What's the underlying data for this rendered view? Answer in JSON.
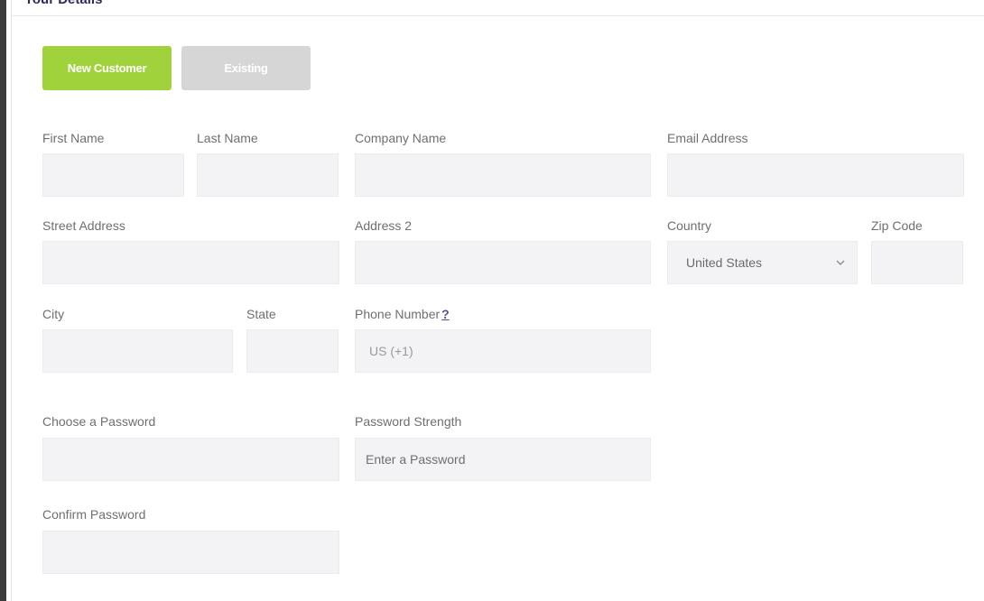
{
  "panel": {
    "title": "Your Details"
  },
  "customer_toggle": {
    "new_label": "New Customer",
    "existing_label": "Existing",
    "active": "new",
    "colors": {
      "active": "#9fd23b",
      "inactive": "#d6d6d6"
    }
  },
  "form": {
    "first_name": {
      "label": "First Name",
      "value": "",
      "placeholder": ""
    },
    "last_name": {
      "label": "Last Name",
      "value": "",
      "placeholder": ""
    },
    "company_name": {
      "label": "Company Name",
      "value": "",
      "placeholder": ""
    },
    "email": {
      "label": "Email Address",
      "value": "",
      "placeholder": ""
    },
    "street_address": {
      "label": "Street Address",
      "value": "",
      "placeholder": ""
    },
    "address2": {
      "label": "Address 2",
      "value": "",
      "placeholder": ""
    },
    "country": {
      "label": "Country",
      "value": "United States"
    },
    "zip": {
      "label": "Zip Code",
      "value": "",
      "placeholder": ""
    },
    "city": {
      "label": "City",
      "value": "",
      "placeholder": ""
    },
    "state": {
      "label": "State",
      "value": "",
      "placeholder": ""
    },
    "phone": {
      "label": "Phone Number",
      "help": "?",
      "value": "",
      "placeholder": "US (+1)"
    },
    "password": {
      "label": "Choose a Password",
      "value": "",
      "placeholder": ""
    },
    "password_strength": {
      "label": "Password Strength",
      "value": "Enter a Password"
    },
    "confirm_password": {
      "label": "Confirm Password",
      "value": "",
      "placeholder": ""
    }
  },
  "icons": {
    "country_dropdown": "chevron-down-icon"
  }
}
